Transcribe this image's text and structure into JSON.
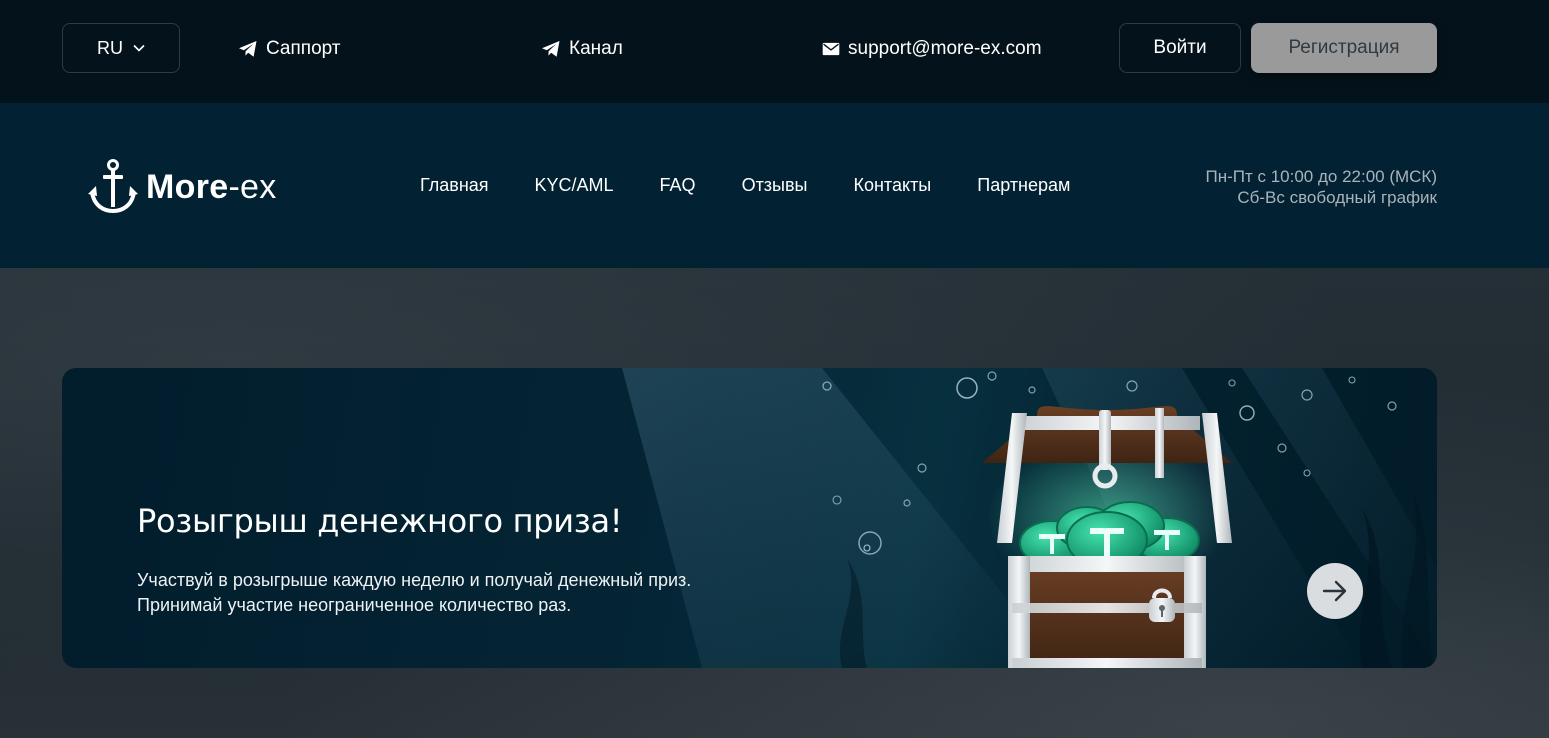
{
  "topbar": {
    "language": "RU",
    "support_label": "Саппорт",
    "channel_label": "Канал",
    "email": "support@more-ex.com",
    "login_label": "Войти",
    "register_label": "Регистрация"
  },
  "navbar": {
    "logo_bold": "More",
    "logo_light": "-ex",
    "items": [
      {
        "label": "Главная"
      },
      {
        "label": "KYC/AML"
      },
      {
        "label": "FAQ"
      },
      {
        "label": "Отзывы"
      },
      {
        "label": "Контакты"
      },
      {
        "label": "Партнерам"
      }
    ],
    "hours_weekdays": "Пн-Пт с 10:00 до 22:00 (МСК)",
    "hours_weekend": "Сб-Вс свободный график"
  },
  "banner": {
    "title": "Розыгрыш денежного приза!",
    "text_line1": "Участвуй в розыгрыше каждую неделю и получай денежный приз.",
    "text_line2": "Принимай участие неограниченное количество раз."
  },
  "colors": {
    "topbar_bg": "#04131b",
    "navbar_bg": "#022133",
    "banner_bg": "#042535",
    "register_button": "#9a9a9a",
    "accent_green": "#1fb98a"
  },
  "icons": {
    "language_dropdown": "chevron-down-icon",
    "support": "telegram-icon",
    "channel": "telegram-icon",
    "email": "mail-icon",
    "logo": "anchor-icon",
    "banner_next": "arrow-right-icon"
  }
}
